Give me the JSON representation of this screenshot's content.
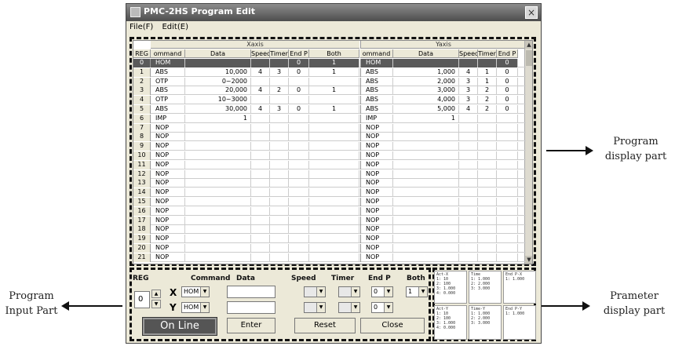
{
  "window": {
    "title": "PMC-2HS Program Edit",
    "close_glyph": "×"
  },
  "menu": [
    {
      "label": "File(F)"
    },
    {
      "label": "Edit(E)"
    }
  ],
  "axes": {
    "x": "Xaxis",
    "y": "Yaxis"
  },
  "columns_x": [
    "REG",
    "ommand",
    "Data",
    "Speed",
    "Timer",
    "End P",
    "Both"
  ],
  "columns_y": [
    "ommand",
    "Data",
    "Speed",
    "Timer",
    "End P"
  ],
  "rows": [
    {
      "reg": "0",
      "xc": "HOM",
      "xd": "",
      "xs": "",
      "xt": "",
      "xe": "0",
      "xb": "1",
      "yc": "HOM",
      "yd": "",
      "ys": "",
      "yt": "",
      "ye": "0"
    },
    {
      "reg": "1",
      "xc": "ABS",
      "xd": "10,000",
      "xs": "4",
      "xt": "3",
      "xe": "0",
      "xb": "1",
      "yc": "ABS",
      "yd": "1,000",
      "ys": "4",
      "yt": "1",
      "ye": "0"
    },
    {
      "reg": "2",
      "xc": "OTP",
      "xd": "0~2000",
      "xs": "",
      "xt": "",
      "xe": "",
      "xb": "",
      "yc": "ABS",
      "yd": "2,000",
      "ys": "3",
      "yt": "1",
      "ye": "0"
    },
    {
      "reg": "3",
      "xc": "ABS",
      "xd": "20,000",
      "xs": "4",
      "xt": "2",
      "xe": "0",
      "xb": "1",
      "yc": "ABS",
      "yd": "3,000",
      "ys": "3",
      "yt": "2",
      "ye": "0"
    },
    {
      "reg": "4",
      "xc": "OTP",
      "xd": "10~3000",
      "xs": "",
      "xt": "",
      "xe": "",
      "xb": "",
      "yc": "ABS",
      "yd": "4,000",
      "ys": "3",
      "yt": "2",
      "ye": "0"
    },
    {
      "reg": "5",
      "xc": "ABS",
      "xd": "30,000",
      "xs": "4",
      "xt": "3",
      "xe": "0",
      "xb": "1",
      "yc": "ABS",
      "yd": "5,000",
      "ys": "4",
      "yt": "2",
      "ye": "0"
    },
    {
      "reg": "6",
      "xc": "IMP",
      "xd": "1",
      "xs": "",
      "xt": "",
      "xe": "",
      "xb": "",
      "yc": "IMP",
      "yd": "1",
      "ys": "",
      "yt": "",
      "ye": ""
    },
    {
      "reg": "7",
      "xc": "NOP",
      "xd": "",
      "xs": "",
      "xt": "",
      "xe": "",
      "xb": "",
      "yc": "NOP",
      "yd": "",
      "ys": "",
      "yt": "",
      "ye": ""
    },
    {
      "reg": "8",
      "xc": "NOP",
      "xd": "",
      "xs": "",
      "xt": "",
      "xe": "",
      "xb": "",
      "yc": "NOP",
      "yd": "",
      "ys": "",
      "yt": "",
      "ye": ""
    },
    {
      "reg": "9",
      "xc": "NOP",
      "xd": "",
      "xs": "",
      "xt": "",
      "xe": "",
      "xb": "",
      "yc": "NOP",
      "yd": "",
      "ys": "",
      "yt": "",
      "ye": ""
    },
    {
      "reg": "10",
      "xc": "NOP",
      "xd": "",
      "xs": "",
      "xt": "",
      "xe": "",
      "xb": "",
      "yc": "NOP",
      "yd": "",
      "ys": "",
      "yt": "",
      "ye": ""
    },
    {
      "reg": "11",
      "xc": "NOP",
      "xd": "",
      "xs": "",
      "xt": "",
      "xe": "",
      "xb": "",
      "yc": "NOP",
      "yd": "",
      "ys": "",
      "yt": "",
      "ye": ""
    },
    {
      "reg": "12",
      "xc": "NOP",
      "xd": "",
      "xs": "",
      "xt": "",
      "xe": "",
      "xb": "",
      "yc": "NOP",
      "yd": "",
      "ys": "",
      "yt": "",
      "ye": ""
    },
    {
      "reg": "13",
      "xc": "NOP",
      "xd": "",
      "xs": "",
      "xt": "",
      "xe": "",
      "xb": "",
      "yc": "NOP",
      "yd": "",
      "ys": "",
      "yt": "",
      "ye": ""
    },
    {
      "reg": "14",
      "xc": "NOP",
      "xd": "",
      "xs": "",
      "xt": "",
      "xe": "",
      "xb": "",
      "yc": "NOP",
      "yd": "",
      "ys": "",
      "yt": "",
      "ye": ""
    },
    {
      "reg": "15",
      "xc": "NOP",
      "xd": "",
      "xs": "",
      "xt": "",
      "xe": "",
      "xb": "",
      "yc": "NOP",
      "yd": "",
      "ys": "",
      "yt": "",
      "ye": ""
    },
    {
      "reg": "16",
      "xc": "NOP",
      "xd": "",
      "xs": "",
      "xt": "",
      "xe": "",
      "xb": "",
      "yc": "NOP",
      "yd": "",
      "ys": "",
      "yt": "",
      "ye": ""
    },
    {
      "reg": "17",
      "xc": "NOP",
      "xd": "",
      "xs": "",
      "xt": "",
      "xe": "",
      "xb": "",
      "yc": "NOP",
      "yd": "",
      "ys": "",
      "yt": "",
      "ye": ""
    },
    {
      "reg": "18",
      "xc": "NOP",
      "xd": "",
      "xs": "",
      "xt": "",
      "xe": "",
      "xb": "",
      "yc": "NOP",
      "yd": "",
      "ys": "",
      "yt": "",
      "ye": ""
    },
    {
      "reg": "19",
      "xc": "NOP",
      "xd": "",
      "xs": "",
      "xt": "",
      "xe": "",
      "xb": "",
      "yc": "NOP",
      "yd": "",
      "ys": "",
      "yt": "",
      "ye": ""
    },
    {
      "reg": "20",
      "xc": "NOP",
      "xd": "",
      "xs": "",
      "xt": "",
      "xe": "",
      "xb": "",
      "yc": "NOP",
      "yd": "",
      "ys": "",
      "yt": "",
      "ye": ""
    },
    {
      "reg": "21",
      "xc": "NOP",
      "xd": "",
      "xs": "",
      "xt": "",
      "xe": "",
      "xb": "",
      "yc": "NOP",
      "yd": "",
      "ys": "",
      "yt": "",
      "ye": ""
    }
  ],
  "selected_row": 0,
  "input": {
    "reg_label": "REG",
    "reg_value": "0",
    "command_label": "Command",
    "data_label": "Data",
    "speed_label": "Speed",
    "timer_label": "Timer",
    "endp_label": "End P",
    "both_label": "Both",
    "x_label": "X",
    "y_label": "Y",
    "x_command": "HOM",
    "y_command": "HOM",
    "x_endp": "0",
    "y_endp": "0",
    "both_value": "1",
    "enter": "Enter",
    "reset": "Reset",
    "close": "Close",
    "online": "On Line"
  },
  "params": [
    "Act-X\n1: 10\n2: 100\n3: 1.000\n4: 0.000",
    "Time\n1: 1.000\n2: 2.000\n3: 3.000",
    "End P-X\n1: 1.000",
    "Act-Y\n1: 10\n2: 100\n3: 1.000\n4: 0.000",
    "Time-Y\n1: 1.000\n2: 2.000\n3: 3.000",
    "End P-Y\n1: 1.000"
  ],
  "annotations": {
    "program_display": "Program\ndisplay part",
    "program_input": "Program\nInput Part",
    "parameter_display": "Prameter\ndisplay part"
  },
  "colors": {
    "selected_row": "#5a5a5a",
    "window_bg": "#ece9d8",
    "titlebar": "#6b6b6b"
  }
}
